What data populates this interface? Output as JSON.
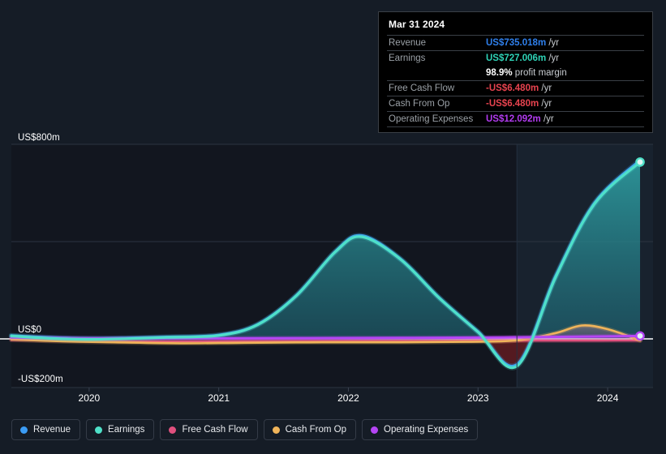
{
  "tooltip": {
    "date": "Mar 31 2024",
    "rows": [
      {
        "label": "Revenue",
        "amount": "US$735.018m",
        "unit": "/yr",
        "color": "#2f80ed"
      },
      {
        "label": "Earnings",
        "amount": "US$727.006m",
        "unit": "/yr",
        "color": "#2ed3b7"
      },
      {
        "label": "",
        "amount": "98.9%",
        "unit": "profit margin",
        "color": "#ffffff",
        "is_margin": true
      },
      {
        "label": "Free Cash Flow",
        "amount": "-US$6.480m",
        "unit": "/yr",
        "color": "#e8434f"
      },
      {
        "label": "Cash From Op",
        "amount": "-US$6.480m",
        "unit": "/yr",
        "color": "#e8434f"
      },
      {
        "label": "Operating Expenses",
        "amount": "US$12.092m",
        "unit": "/yr",
        "color": "#b23bf0"
      }
    ]
  },
  "legend": {
    "items": [
      {
        "label": "Revenue",
        "color": "#3b9cf5"
      },
      {
        "label": "Earnings",
        "color": "#4fe0c8"
      },
      {
        "label": "Free Cash Flow",
        "color": "#e0507e"
      },
      {
        "label": "Cash From Op",
        "color": "#f0b45a"
      },
      {
        "label": "Operating Expenses",
        "color": "#b545f5"
      }
    ]
  },
  "chart_data": {
    "type": "area",
    "title": "",
    "xlabel": "",
    "ylabel": "",
    "x_tick_labels": [
      "2020",
      "2021",
      "2022",
      "2023",
      "2024"
    ],
    "x_tick_values": [
      2020,
      2021,
      2022,
      2023,
      2024
    ],
    "y_tick_labels": [
      "US$800m",
      "US$0",
      "-US$200m"
    ],
    "ylim": [
      -200,
      800
    ],
    "yunit": "US$m",
    "gridlines": [
      800,
      400,
      0,
      -200
    ],
    "grid": true,
    "legend_position": "bottom",
    "forecast_region_start": 2023.3,
    "xlim": [
      2019.4,
      2024.35
    ],
    "series": [
      {
        "name": "Revenue",
        "color": "#3b9cf5",
        "x": [
          2019.4,
          2019.7,
          2020.0,
          2020.3,
          2020.6,
          2021.0,
          2021.3,
          2021.6,
          2021.9,
          2022.1,
          2022.4,
          2022.7,
          2023.0,
          2023.3,
          2023.6,
          2023.9,
          2024.25
        ],
        "values": [
          14,
          6,
          2,
          4,
          8,
          16,
          60,
          180,
          360,
          425,
          330,
          170,
          30,
          -105,
          260,
          560,
          735
        ]
      },
      {
        "name": "Earnings",
        "color": "#4fe0c8",
        "x": [
          2019.4,
          2019.7,
          2020.0,
          2020.3,
          2020.6,
          2021.0,
          2021.3,
          2021.6,
          2021.9,
          2022.1,
          2022.4,
          2022.7,
          2023.0,
          2023.3,
          2023.6,
          2023.9,
          2024.25
        ],
        "values": [
          12,
          2,
          -2,
          1,
          6,
          14,
          58,
          178,
          358,
          420,
          328,
          168,
          28,
          -112,
          255,
          556,
          727
        ]
      },
      {
        "name": "Free Cash Flow",
        "color": "#e0507e",
        "x": [
          2019.4,
          2020.0,
          2020.6,
          2021.3,
          2022.0,
          2022.7,
          2023.3,
          2023.8,
          2024.25
        ],
        "values": [
          -4,
          -8,
          -10,
          -9,
          -8,
          -8,
          -7,
          -7,
          -6.48
        ]
      },
      {
        "name": "Cash From Op",
        "color": "#f0b45a",
        "x": [
          2019.4,
          2019.8,
          2020.2,
          2020.7,
          2021.2,
          2021.8,
          2022.4,
          2022.9,
          2023.3,
          2023.6,
          2023.8,
          2024.0,
          2024.25
        ],
        "values": [
          -2,
          -10,
          -14,
          -18,
          -16,
          -14,
          -14,
          -12,
          -6,
          24,
          55,
          40,
          -6.48
        ]
      },
      {
        "name": "Operating Expenses",
        "color": "#b545f5",
        "x": [
          2019.4,
          2020.0,
          2020.8,
          2021.6,
          2022.4,
          2023.2,
          2023.8,
          2024.25
        ],
        "values": [
          6,
          2,
          2,
          3,
          4,
          6,
          9,
          12.092
        ]
      }
    ],
    "end_markers": [
      {
        "series": "Earnings",
        "x": 2024.25,
        "value": 727
      },
      {
        "series": "Operating Expenses",
        "x": 2024.25,
        "value": 12.092
      }
    ]
  }
}
